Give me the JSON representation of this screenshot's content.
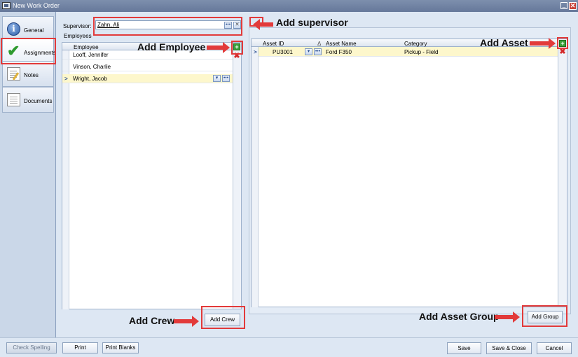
{
  "window": {
    "title": "New Work Order",
    "minimize_glyph": "_",
    "close_glyph": "✕"
  },
  "sidebar": {
    "items": [
      {
        "label": "General",
        "icon": "info-icon"
      },
      {
        "label": "Assignments",
        "icon": "checkmark-icon"
      },
      {
        "label": "Notes",
        "icon": "notes-icon"
      },
      {
        "label": "Documents",
        "icon": "documents-icon"
      }
    ]
  },
  "supervisor": {
    "label": "Supervisor:",
    "value": "Zahn, Ali",
    "ellipsis": "•••",
    "clear": "✕"
  },
  "employees": {
    "caption": "Employees",
    "column": "Employee",
    "rows": [
      "Looff, Jennifer",
      "Vinson, Charlie",
      "Wright, Jacob"
    ],
    "selected_marker": ">",
    "dropdown_glyph": "▾",
    "ellipsis": "•••",
    "add_glyph": "+",
    "remove_glyph": "✖"
  },
  "assets": {
    "columns": {
      "asset_id": "Asset ID",
      "sort": "Δ",
      "asset_name": "Asset Name",
      "category": "Category"
    },
    "rows": [
      {
        "asset_id": "PU3001",
        "asset_name": "Ford F350",
        "category": "Pickup - Field"
      }
    ],
    "selected_marker": ">",
    "dropdown_glyph": "▾",
    "ellipsis": "•••",
    "add_glyph": "+",
    "remove_glyph": "✖"
  },
  "buttons": {
    "add_crew": "Add Crew",
    "add_group": "Add Group",
    "check_spelling": "Check Spelling",
    "print": "Print",
    "print_blanks": "Print Blanks",
    "save": "Save",
    "save_close": "Save & Close",
    "cancel": "Cancel"
  },
  "annotations": {
    "add_supervisor": "Add supervisor",
    "add_employee": "Add Employee",
    "add_asset": "Add Asset",
    "add_crew": "Add Crew",
    "add_asset_group": "Add Asset Group"
  },
  "colors": {
    "highlight": "#e23a3a",
    "selected_row": "#fdf7cc",
    "add_green": "#3aa13a"
  }
}
